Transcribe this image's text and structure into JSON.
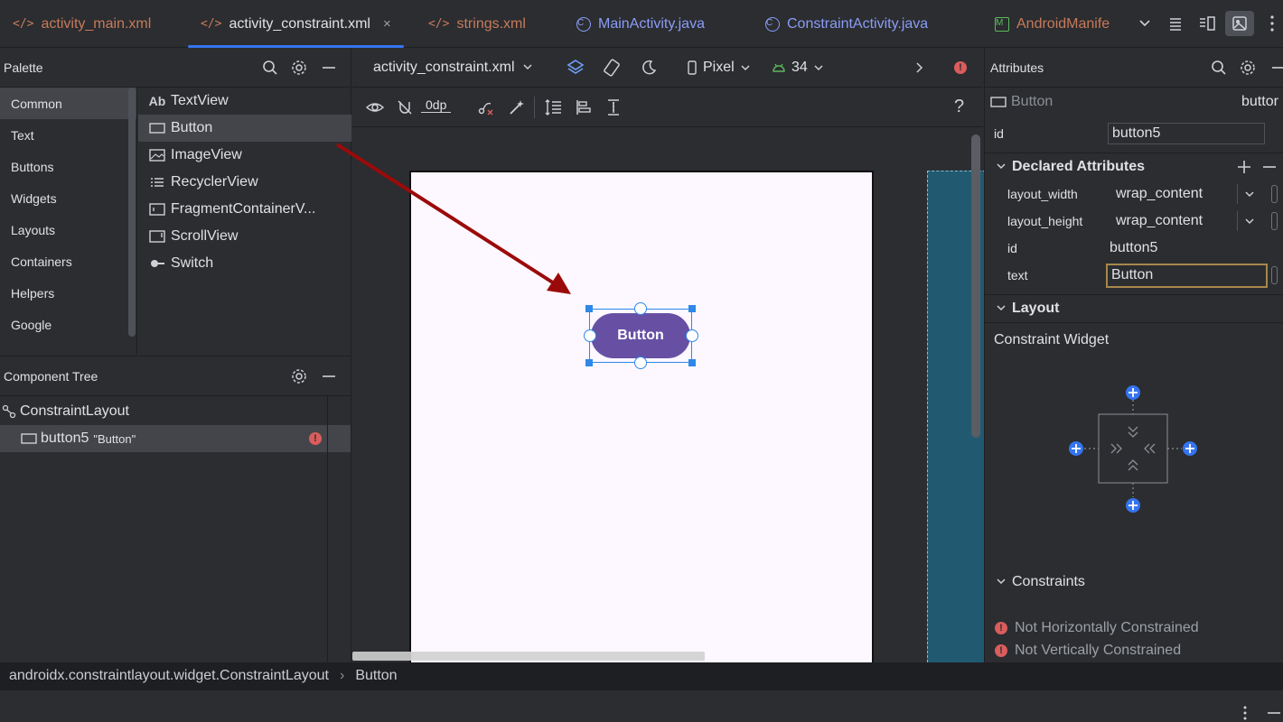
{
  "tabs": [
    {
      "label": "activity_main.xml",
      "icon": "xml-icon",
      "kind": "xml"
    },
    {
      "label": "activity_constraint.xml",
      "icon": "xml-icon",
      "kind": "xml",
      "active": true
    },
    {
      "label": "strings.xml",
      "icon": "xml-icon",
      "kind": "xml"
    },
    {
      "label": "MainActivity.java",
      "icon": "java-class-icon",
      "kind": "java"
    },
    {
      "label": "ConstraintActivity.java",
      "icon": "java-class-icon",
      "kind": "java"
    },
    {
      "label": "AndroidManife",
      "icon": "manifest-icon",
      "kind": "manifest"
    }
  ],
  "tab_glyphs": {
    "xml": "</>",
    "java": "C",
    "manifest": "M",
    "close": "×"
  },
  "palette": {
    "title": "Palette",
    "categories": [
      "Common",
      "Text",
      "Buttons",
      "Widgets",
      "Layouts",
      "Containers",
      "Helpers",
      "Google"
    ],
    "selected_category": "Common",
    "widgets": [
      {
        "label": "TextView",
        "icon": "text-view-icon",
        "glyph": "Ab"
      },
      {
        "label": "Button",
        "icon": "button-icon"
      },
      {
        "label": "ImageView",
        "icon": "image-view-icon"
      },
      {
        "label": "RecyclerView",
        "icon": "recycler-view-icon"
      },
      {
        "label": "FragmentContainerV...",
        "icon": "fragment-container-icon"
      },
      {
        "label": "ScrollView",
        "icon": "scroll-view-icon"
      },
      {
        "label": "Switch",
        "icon": "switch-icon"
      }
    ]
  },
  "component_tree": {
    "title": "Component Tree",
    "root": "ConstraintLayout",
    "child_id": "button5",
    "child_text": "\"Button\""
  },
  "editor": {
    "file_selector": "activity_constraint.xml",
    "device": "Pixel",
    "api_level": "34",
    "margin_value": "0dp",
    "help_glyph": "?",
    "canvas_button_label": "Button"
  },
  "attributes": {
    "title": "Attributes",
    "widget_type": "Button",
    "widget_id_truncated": "buttor",
    "id_label": "id",
    "id_value": "button5",
    "declared_title": "Declared Attributes",
    "declared": [
      {
        "key": "layout_width",
        "value": "wrap_content"
      },
      {
        "key": "layout_height",
        "value": "wrap_content"
      },
      {
        "key": "id",
        "value": "button5"
      },
      {
        "key": "text",
        "value": "Button"
      }
    ],
    "layout_title": "Layout",
    "constraint_widget_label": "Constraint Widget",
    "constraints_title": "Constraints",
    "constraint_warnings": [
      "Not Horizontally Constrained",
      "Not Vertically Constrained"
    ]
  },
  "statusbar": {
    "path": "androidx.constraintlayout.widget.ConstraintLayout",
    "separator": "›",
    "leaf": "Button"
  },
  "colors": {
    "accent": "#3574f0",
    "button_fill": "#6750a4",
    "error": "#db5c5c",
    "blueprint": "#215a70",
    "arrow": "#9b0a0a"
  }
}
